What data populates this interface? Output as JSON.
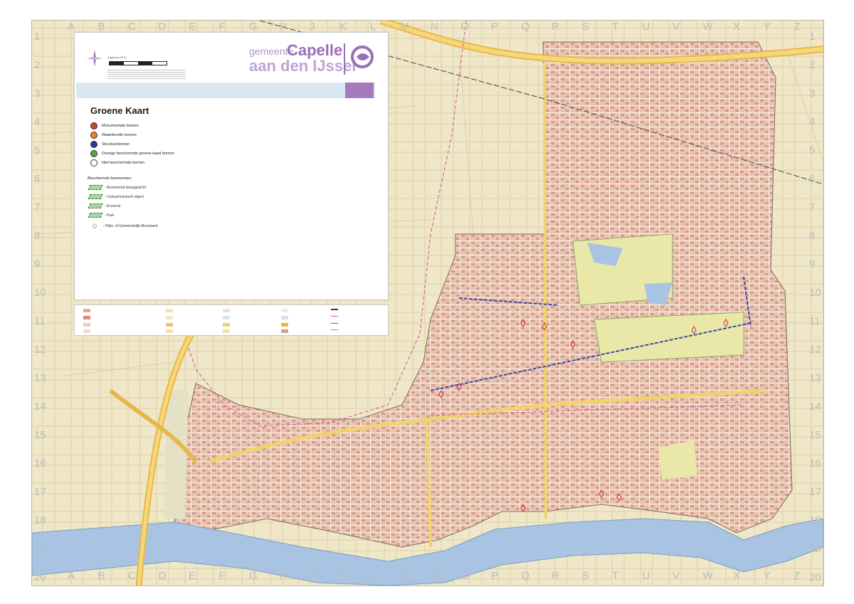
{
  "map": {
    "grid_letters": [
      "A",
      "B",
      "C",
      "D",
      "E",
      "F",
      "G",
      "H",
      "J",
      "K",
      "L",
      "M",
      "N",
      "O",
      "P",
      "Q",
      "R",
      "S",
      "T",
      "U",
      "V",
      "W",
      "X",
      "Y",
      "Z"
    ],
    "grid_numbers": [
      "1",
      "2",
      "3",
      "4",
      "5",
      "6",
      "7",
      "8",
      "9",
      "10",
      "11",
      "12",
      "13",
      "14",
      "15",
      "16",
      "17",
      "18",
      "19",
      "20"
    ]
  },
  "header": {
    "date": "Augustus 2014",
    "logo_gemeente": "gemeente",
    "logo_capelle": "Capelle",
    "logo_line2": "aan den IJssel"
  },
  "legend": {
    "title": "Groene Kaart",
    "items": [
      {
        "label": "Monumentale bomen",
        "color": "#d2451e"
      },
      {
        "label": "Waardevolle bomen",
        "color": "#ef7d2b"
      },
      {
        "label": "Structuurbomen",
        "color": "#2b3a8f"
      },
      {
        "label": "Overige beschermde groene kaart bomen",
        "color": "#4caf3a"
      },
      {
        "label": "Niet beschermde bomen",
        "color": "#ffffff"
      }
    ],
    "zones_title": "Beschermde boomzones:",
    "zones": [
      {
        "label": "- Beschermd dorpsgezicht"
      },
      {
        "label": "- Cultuurhistorisch object"
      },
      {
        "label": "- Ecozone"
      },
      {
        "label": "- Park"
      },
      {
        "label": "- Rijks- of Gemeentelijk Monument"
      }
    ]
  },
  "colors": {
    "background": "#efe7c8",
    "water": "#a9c4e2",
    "built": "#e7b8a8",
    "road": "#f2d36b",
    "purple": "#9a6fb5"
  }
}
